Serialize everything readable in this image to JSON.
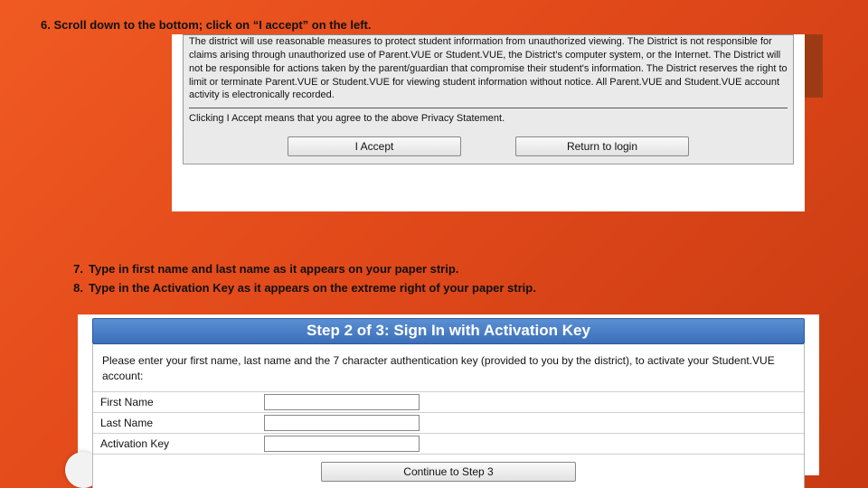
{
  "step6_label": "6. Scroll down to the bottom; click on “I accept” on the left.",
  "step7_num": "7.",
  "step7_text": "Type in first name and last name as it appears on your paper strip.",
  "step8_num": "8.",
  "step8_text": "Type in the Activation Key as it appears on the extreme right of your paper strip.",
  "panel1": {
    "privacy_text": "The district will use reasonable measures to protect student information from unauthorized viewing. The District is not responsible for claims arising through unauthorized use of Parent.VUE or Student.VUE, the District's computer system, or the Internet. The District will not be responsible for actions taken by the parent/guardian that compromise their student's information. The District reserves the right to limit or terminate Parent.VUE or Student.VUE for viewing student information without notice. All Parent.VUE and Student.VUE account activity is electronically recorded.",
    "agree_line": "Clicking I Accept means that you agree to the above Privacy Statement.",
    "btn_accept": "I Accept",
    "btn_return": "Return to login"
  },
  "panel2": {
    "header": "Step 2 of 3: Sign In with Activation Key",
    "intro": "Please enter your first name, last name and the 7 character authentication key (provided to you by the district), to activate your Student.VUE account:",
    "label_first": "First Name",
    "label_last": "Last Name",
    "label_key": "Activation Key",
    "btn_continue": "Continue to Step 3"
  }
}
